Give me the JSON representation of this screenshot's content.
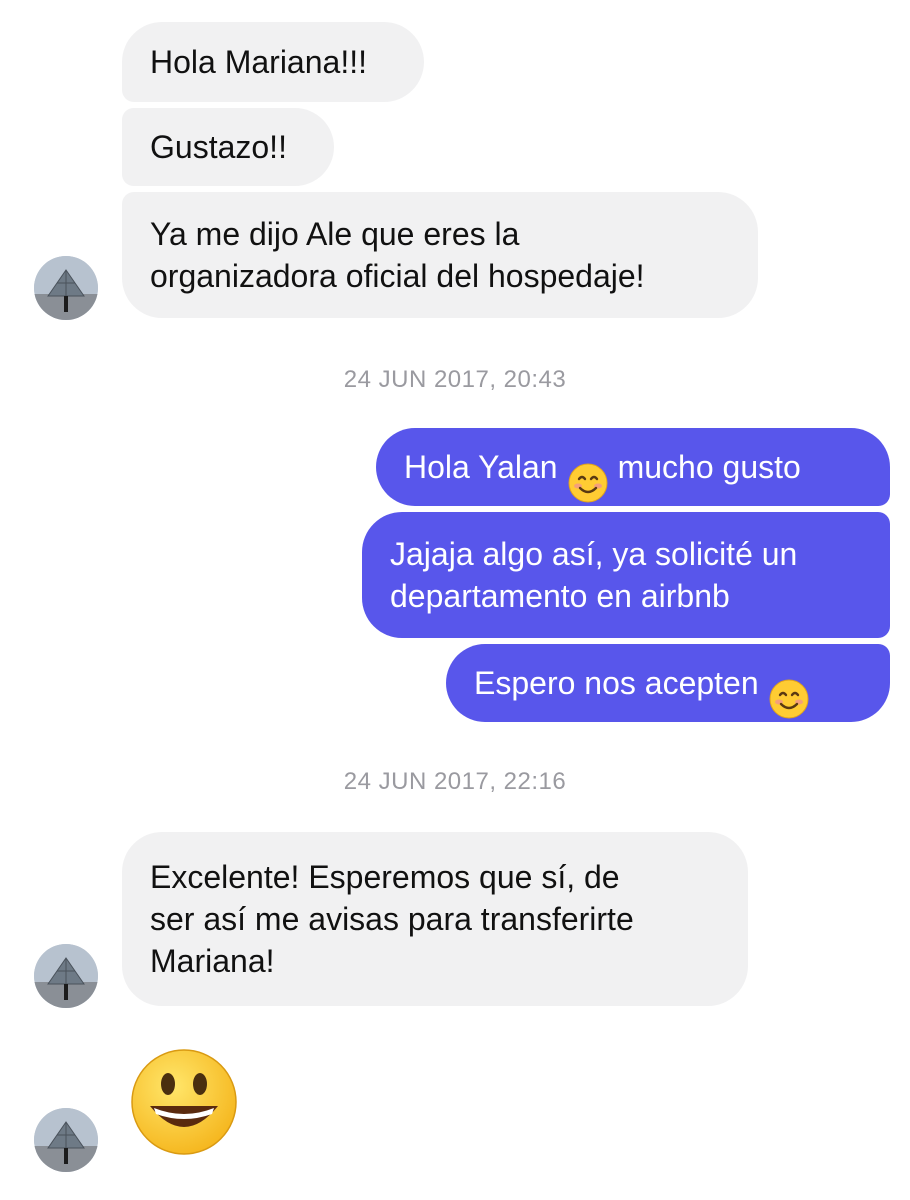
{
  "messages": {
    "m1": "Hola Mariana!!!",
    "m2": "Gustazo!!",
    "m3": "Ya me dijo Ale que eres la\norganizadora oficial del hospedaje!",
    "ts1": "24 JUN 2017, 20:43",
    "m4_before": "Hola Yalan",
    "m4_after": "mucho gusto",
    "m4_emoji": "smiling-face-icon",
    "m5": "Jajaja algo así, ya solicité un\ndepartamento en airbnb",
    "m6": "Espero nos acepten",
    "m6_emoji": "smiling-face-icon",
    "ts2": "24 JUN 2017, 22:16",
    "m7": "Excelente! Esperemos que sí, de\nser así me avisas para transferirte\nMariana!",
    "m8_emoji": "grinning-face-icon"
  },
  "colors": {
    "incoming_bubble": "#f1f1f2",
    "outgoing_bubble": "#5856eb",
    "timestamp": "#9a9aa0"
  },
  "icons": [
    "avatar",
    "smiling-face-icon",
    "grinning-face-icon"
  ]
}
